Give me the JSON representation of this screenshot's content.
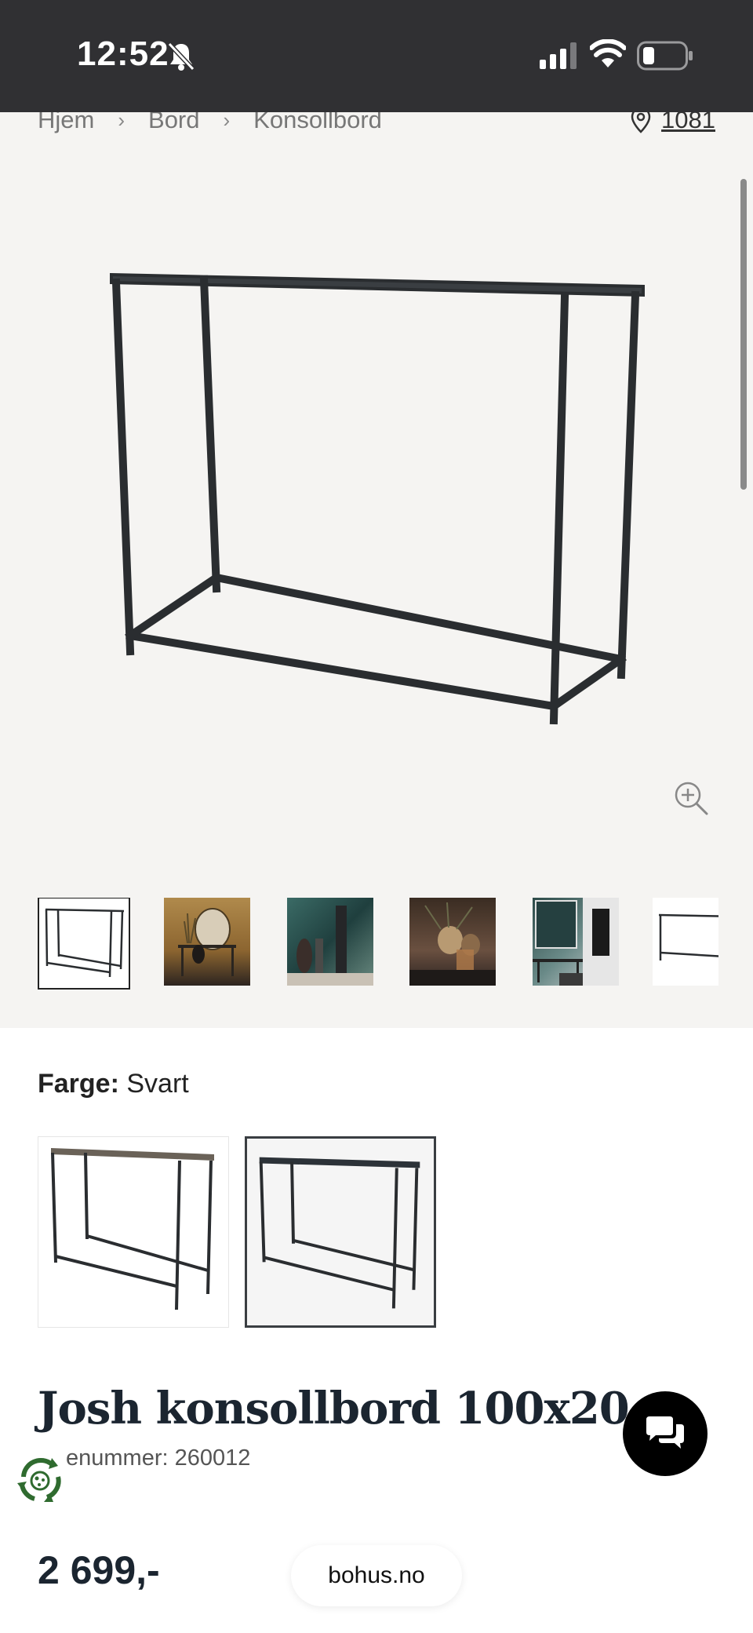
{
  "status_bar": {
    "time": "12:52",
    "silent_icon": "bell-slash-icon",
    "signal_icon": "cellular-signal-icon",
    "wifi_icon": "wifi-icon",
    "battery_icon": "battery-low-icon"
  },
  "breadcrumb": {
    "items": [
      "Hjem",
      "Bord",
      "Konsollbord"
    ],
    "separator": "›"
  },
  "store": {
    "icon": "location-pin-icon",
    "label": "1081"
  },
  "gallery": {
    "zoom_icon": "zoom-in-icon",
    "thumbnail_count": 6,
    "active_thumbnail": 1
  },
  "color": {
    "label": "Farge:",
    "value": "Svart",
    "options": [
      "Svart 1",
      "Svart 2"
    ],
    "selected_option": 2
  },
  "product": {
    "title": "Josh konsollbord 100x20",
    "item_number": "enummer: 260012",
    "price": "2 699,-"
  },
  "chat": {
    "icon": "chat-bubbles-icon"
  },
  "recycle": {
    "icon": "recycle-icon"
  },
  "browser": {
    "url": "bohus.no"
  },
  "colors": {
    "status_bar": "#303033",
    "gallery_bg": "#f5f4f2",
    "title": "#1b2530",
    "chat_button": "#000000"
  }
}
